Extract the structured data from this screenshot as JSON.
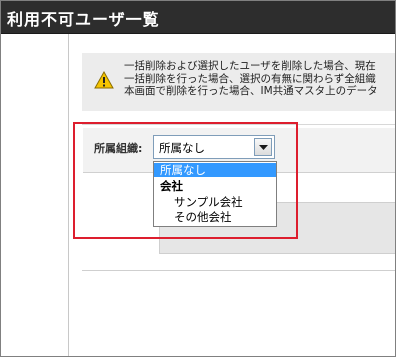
{
  "window": {
    "title": "利用不可ユーザ一覧"
  },
  "warning": {
    "icon": "warning-triangle-icon",
    "lines": [
      "一括削除および選択したユーザを削除した場合、現在",
      "一括削除を行った場合、選択の有無に関わらず全組織",
      "本画面で削除を行った場合、IM共通マスタ上のデータ"
    ]
  },
  "filter": {
    "label": "所属組織:",
    "selected_value": "所属なし",
    "options": [
      {
        "label": "所属なし",
        "selected": true,
        "group": false,
        "indent": 0
      },
      {
        "label": "会社",
        "selected": false,
        "group": true,
        "indent": 0
      },
      {
        "label": "サンプル会社",
        "selected": false,
        "group": false,
        "indent": 1
      },
      {
        "label": "その他会社",
        "selected": false,
        "group": false,
        "indent": 1
      }
    ]
  },
  "colors": {
    "titlebar": "#2d2d2d",
    "highlight": "#dd1e2e",
    "selection": "#3399ff",
    "warning": "#f5c400"
  }
}
